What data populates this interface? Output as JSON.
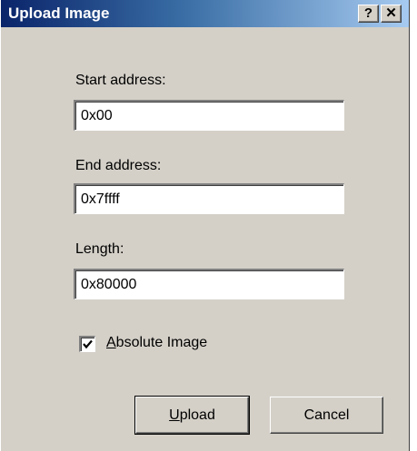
{
  "window": {
    "title": "Upload Image",
    "help_glyph": "?",
    "close_glyph": "✕"
  },
  "form": {
    "start_address": {
      "label": "Start address:",
      "value": "0x00"
    },
    "end_address": {
      "label": "End address:",
      "value": "0x7ffff"
    },
    "length": {
      "label": "Length:",
      "value": "0x80000"
    },
    "absolute_image": {
      "label_first": "A",
      "label_rest": "bsolute Image",
      "checked": true
    }
  },
  "buttons": {
    "upload_first": "U",
    "upload_rest": "pload",
    "cancel": "Cancel"
  },
  "colors": {
    "title_gradient_start": "#0a246a",
    "title_gradient_end": "#a6caf0",
    "dialog_face": "#d4d0c8"
  }
}
